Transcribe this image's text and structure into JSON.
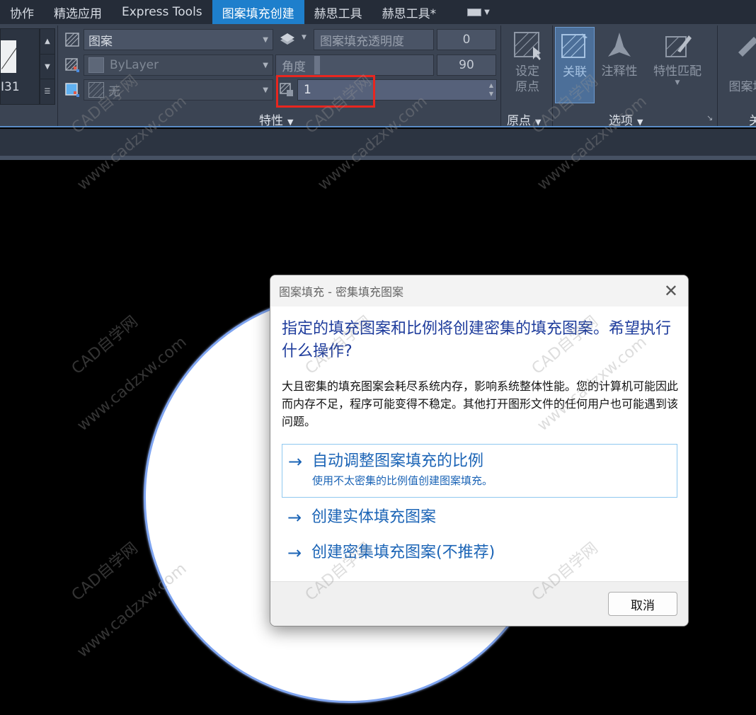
{
  "tabs": [
    "协作",
    "精选应用",
    "Express Tools",
    "图案填充创建",
    "赫思工具",
    "赫思工具*"
  ],
  "active_tab_index": 3,
  "left_panel": {
    "swatch_label": "I31"
  },
  "properties": {
    "pattern_type": "图案",
    "transparency_label": "图案填充透明度",
    "transparency_value": "0",
    "color": "ByLayer",
    "angle_label": "角度",
    "angle_value": "90",
    "background": "无",
    "scale_value": "1",
    "panel_title": "特性"
  },
  "origin_panel": {
    "button_label_line1": "设定",
    "button_label_line2": "原点",
    "panel_title": "原点"
  },
  "options_panel": {
    "associative": "关联",
    "annotative": "注释性",
    "match_properties": "特性匹配",
    "panel_title": "选项"
  },
  "close_panel": {
    "line1": "关",
    "line2": "图案填",
    "panel_title": "关"
  },
  "watermark": {
    "line1": "CAD自学网",
    "line2": "www.cadzxw.com"
  },
  "dialog": {
    "title": "图案填充 - 密集填充图案",
    "heading": "指定的填充图案和比例将创建密集的填充图案。希望执行什么操作?",
    "body": "大且密集的填充图案会耗尽系统内存，影响系统整体性能。您的计算机可能因此而内存不足，程序可能变得不稳定。其他打开图形文件的任何用户也可能遇到该问题。",
    "options": [
      {
        "label": "自动调整图案填充的比例",
        "sub": "使用不太密集的比例值创建图案填充。"
      },
      {
        "label": "创建实体填充图案"
      },
      {
        "label": "创建密集填充图案(不推荐)"
      }
    ],
    "cancel": "取消"
  },
  "colors": {
    "active_tab": "#1e7fcc",
    "dialog_heading": "#1e3c9c",
    "option_link": "#1b64b6",
    "highlight_box": "#e8261f",
    "circle_outline": "#7ea4f0"
  }
}
